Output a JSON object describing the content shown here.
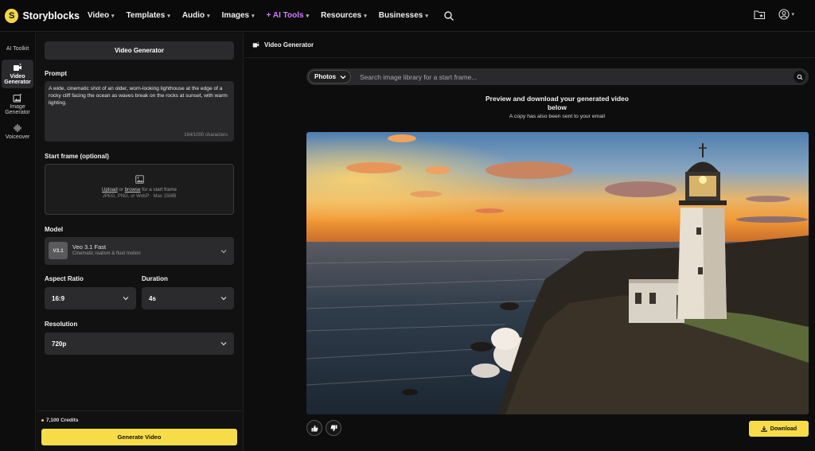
{
  "brand": {
    "name": "Storyblocks",
    "logo_letter": "S",
    "accent": "#f7dc4a",
    "ai_color": "#d17bff"
  },
  "nav": {
    "items": [
      {
        "label": "Video"
      },
      {
        "label": "Templates"
      },
      {
        "label": "Audio"
      },
      {
        "label": "Images"
      },
      {
        "label": "+ AI Tools"
      },
      {
        "label": "Resources"
      },
      {
        "label": "Businesses"
      }
    ],
    "icons": [
      "search-icon",
      "folder-star-icon",
      "user-icon"
    ]
  },
  "rail": {
    "items": [
      {
        "label": "AI Toolkit",
        "icon": "none"
      },
      {
        "label": "Video Generator",
        "icon": "video-sparkle-icon",
        "active": true
      },
      {
        "label": "Image Generator",
        "icon": "image-sparkle-icon"
      },
      {
        "label": "Voiceover",
        "icon": "waveform-icon"
      }
    ]
  },
  "panel": {
    "tab": "Video Generator",
    "prompt_label": "Prompt",
    "prompt_text": "A wide, cinematic shot of an older, worn-looking lighthouse at the edge of a rocky cliff facing the ocean as waves break on the rocks at sunset, with warm lighting.",
    "prompt_count": "164/1000 characters",
    "start_frame_label": "Start frame (optional)",
    "upload_link": "Upload",
    "upload_or": " or ",
    "browse_link": "browse",
    "upload_suffix": " for a start frame",
    "upload_formats": "JPEG, PNG, or WebP · Max 15MB",
    "model_label": "Model",
    "model_badge": "V3.1",
    "model_name": "Veo 3.1 Fast",
    "model_desc": "Cinematic realism & fluid motion",
    "aspect_label": "Aspect Ratio",
    "aspect_value": "16:9",
    "duration_label": "Duration",
    "duration_value": "4s",
    "resolution_label": "Resolution",
    "resolution_value": "720p",
    "credits": "7,100 Credits",
    "generate_label": "Generate Video"
  },
  "main": {
    "title": "Video Generator",
    "search_filter": "Photos",
    "search_placeholder": "Search image library for a start frame...",
    "preview_title": "Preview and download your generated video below",
    "preview_sub": "A copy has also been sent to your email",
    "download_label": "Download"
  }
}
